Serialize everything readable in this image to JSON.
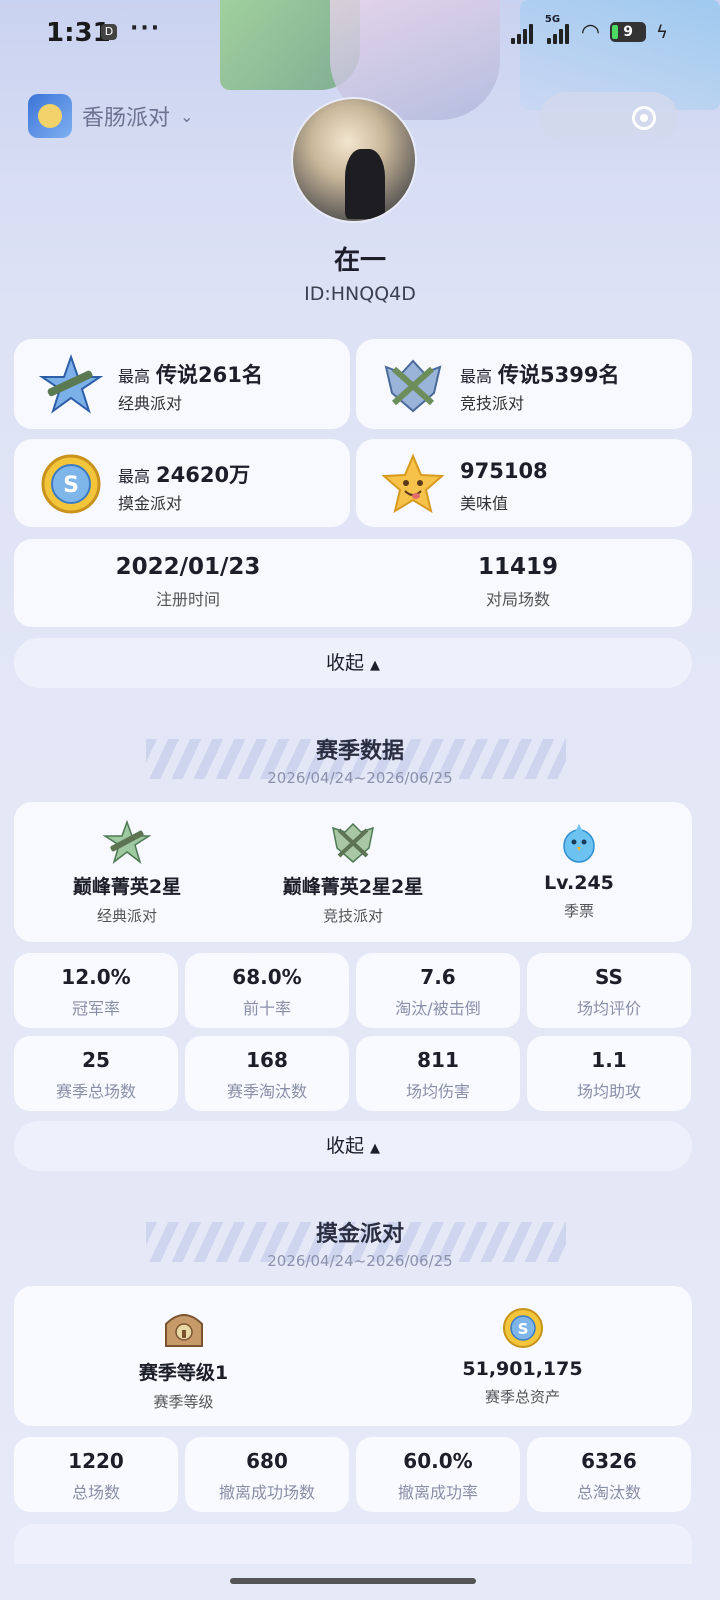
{
  "status_bar": {
    "time": "1:31",
    "app_badge": "D",
    "dots": "···",
    "net_label": "5G",
    "battery": "9"
  },
  "mini_app": {
    "name": "香肠派对",
    "chevron": "⌄"
  },
  "profile": {
    "nickname": "在一",
    "id": "ID:HNQQ4D"
  },
  "records": [
    {
      "prefix": "最高",
      "value": "传说261名",
      "label": "经典派对",
      "icon": "classic-rank-badge-icon"
    },
    {
      "prefix": "最高",
      "value": "传说5399名",
      "label": "竞技派对",
      "icon": "competitive-rank-badge-icon"
    },
    {
      "prefix": "最高",
      "value": "24620万",
      "label": "摸金派对",
      "icon": "gold-coin-icon"
    },
    {
      "prefix": "",
      "value": "975108",
      "label": "美味值",
      "icon": "star-face-icon"
    }
  ],
  "account": {
    "register_date": "2022/01/23",
    "register_label": "注册时间",
    "matches": "11419",
    "matches_label": "对局场数"
  },
  "collapse_label": "收起",
  "collapse_arrow": "▲",
  "season": {
    "title": "赛季数据",
    "date_range": "2026/04/24~2026/06/25",
    "ranks": [
      {
        "value": "巅峰菁英2星",
        "label": "经典派对",
        "icon": "classic-rank-icon"
      },
      {
        "value": "巅峰菁英2星2星",
        "label": "竞技派对",
        "icon": "competitive-rank-icon"
      },
      {
        "value": "Lv.245",
        "label": "季票",
        "icon": "season-pass-bird-icon"
      }
    ],
    "stats": [
      {
        "value": "12.0%",
        "label": "冠军率"
      },
      {
        "value": "68.0%",
        "label": "前十率"
      },
      {
        "value": "7.6",
        "label": "淘汰/被击倒"
      },
      {
        "value": "SS",
        "label": "场均评价"
      },
      {
        "value": "25",
        "label": "赛季总场数"
      },
      {
        "value": "168",
        "label": "赛季淘汰数"
      },
      {
        "value": "811",
        "label": "场均伤害"
      },
      {
        "value": "1.1",
        "label": "场均助攻"
      }
    ]
  },
  "gold": {
    "title": "摸金派对",
    "date_range": "2026/04/24~2026/06/25",
    "summary": [
      {
        "value": "赛季等级1",
        "label": "赛季等级",
        "icon": "season-level-chest-icon"
      },
      {
        "value": "51,901,175",
        "label": "赛季总资产",
        "icon": "gold-coin-icon"
      }
    ],
    "stats": [
      {
        "value": "1220",
        "label": "总场数"
      },
      {
        "value": "680",
        "label": "撤离成功场数"
      },
      {
        "value": "60.0%",
        "label": "撤离成功率"
      },
      {
        "value": "6326",
        "label": "总淘汰数"
      }
    ]
  }
}
